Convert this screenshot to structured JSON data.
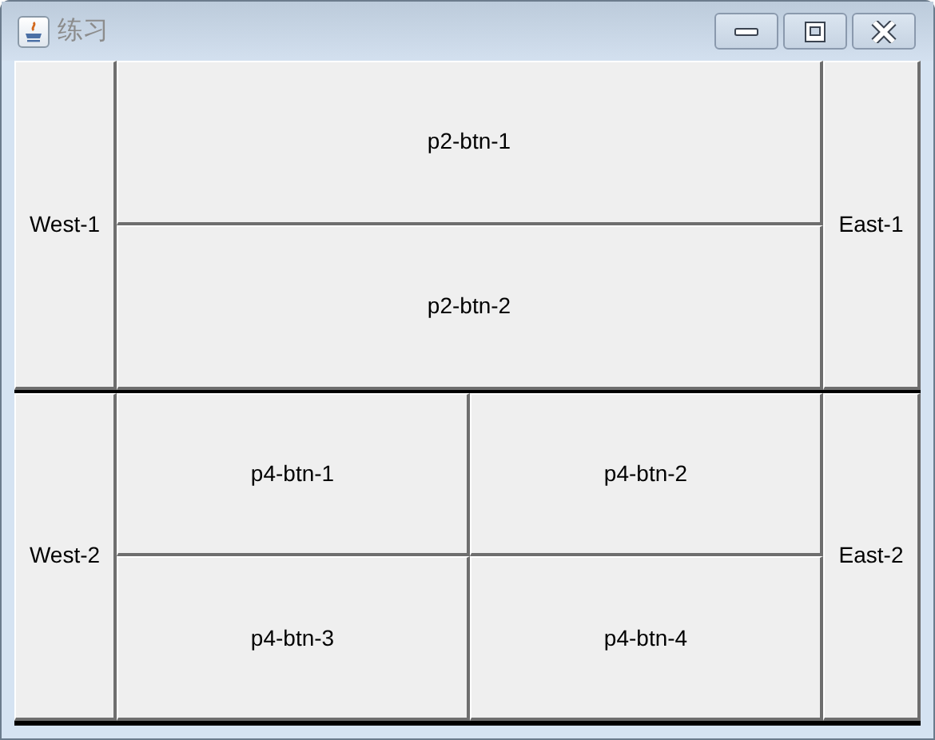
{
  "window": {
    "title": "练习",
    "active": false
  },
  "panels": [
    {
      "west": "West-1",
      "east": "East-1",
      "center": {
        "kind": "stack",
        "buttons": [
          "p2-btn-1",
          "p2-btn-2"
        ]
      }
    },
    {
      "west": "West-2",
      "east": "East-2",
      "center": {
        "kind": "grid",
        "buttons": [
          "p4-btn-1",
          "p4-btn-2",
          "p4-btn-3",
          "p4-btn-4"
        ]
      }
    }
  ]
}
